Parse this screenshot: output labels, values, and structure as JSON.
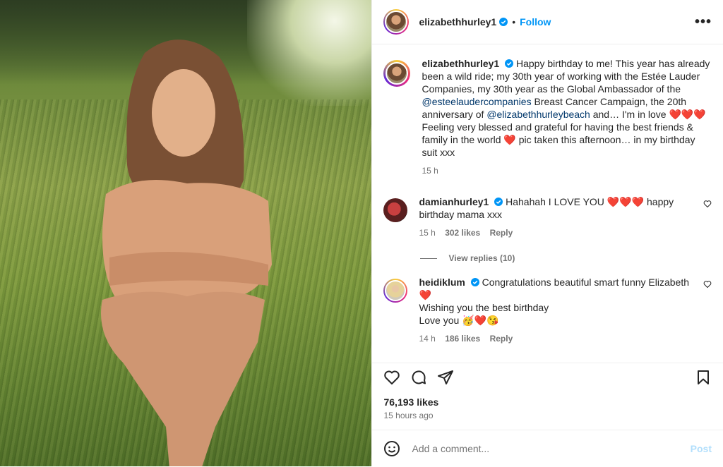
{
  "post": {
    "username": "elizabethhurley1",
    "follow_label": "Follow",
    "dot": "•",
    "more_label": "•••"
  },
  "caption": {
    "username": "elizabethhurley1",
    "text_1": "Happy birthday to me! This year has already been a wild ride; my 30th year of working with the Estée Lauder Companies, my 30th year as the Global Ambassador of the ",
    "mention_1": "@esteelaudercompanies",
    "text_2": " Breast Cancer Campaign, the 20th anniversary of ",
    "mention_2": "@elizabethhurleybeach",
    "text_3": " and… I'm in love ",
    "hearts_1": "❤️❤️❤️",
    "text_4": " Feeling very blessed and grateful for having the best friends & family in the world ",
    "heart_2": "❤️",
    "text_5": " pic taken this afternoon… in my birthday suit xxx",
    "time": "15 h"
  },
  "comments": [
    {
      "username": "damianhurley1",
      "text_1": "Hahahah I LOVE YOU ",
      "hearts": "❤️❤️❤️",
      "text_2": " happy birthday mama xxx",
      "time": "15 h",
      "likes": "302 likes",
      "reply": "Reply"
    },
    {
      "username": "heidiklum",
      "text_1": "Congratulations beautiful smart funny Elizabeth ",
      "heart": "❤️",
      "line_2": "Wishing you the best birthday",
      "line_3": "Love you ",
      "emojis": "🥳❤️😘",
      "time": "14 h",
      "likes": "186 likes",
      "reply": "Reply"
    }
  ],
  "view_replies": "View replies (10)",
  "footer": {
    "likes": "76,193 likes",
    "time": "15 hours ago",
    "comment_placeholder": "Add a comment...",
    "post_label": "Post"
  },
  "colors": {
    "accent": "#0095f6",
    "link": "#00376b",
    "muted": "#737373",
    "post_disabled": "#b2dffc"
  },
  "icons": [
    "verified-badge-icon",
    "more-options-icon",
    "like-icon",
    "comment-icon",
    "share-icon",
    "save-icon",
    "emoji-icon",
    "comment-like-icon"
  ]
}
